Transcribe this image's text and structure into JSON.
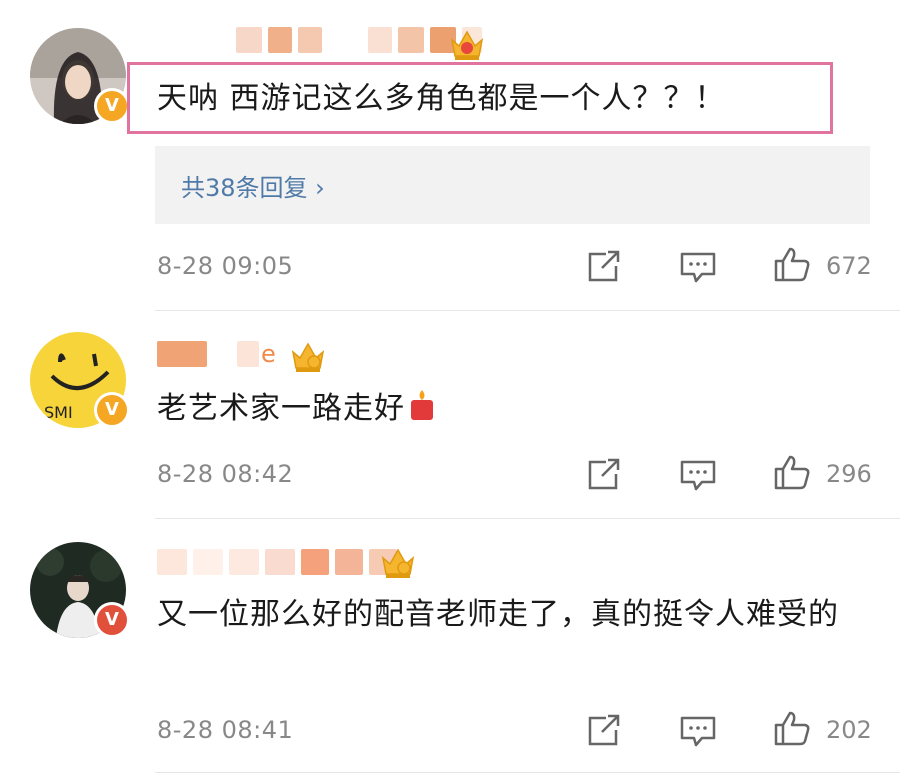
{
  "comments": [
    {
      "username": "",
      "text": "天呐 西游记这么多角色都是一个人？？！",
      "replies_label": "共38条回复 ›",
      "time": "8-28 09:05",
      "likes": "672"
    },
    {
      "username": "e",
      "text": "老艺术家一路走好",
      "time": "8-28 08:42",
      "likes": "296"
    },
    {
      "username": "",
      "text": "又一位那么好的配音老师走了，真的挺令人难受的",
      "time": "8-28 08:41",
      "likes": "202"
    }
  ],
  "icons": {
    "verified": "v-badge-icon",
    "crown": "crown-icon",
    "share": "share-icon",
    "comment": "comment-icon",
    "like": "like-icon",
    "candle": "candle-emoji-icon"
  },
  "badge_text": "V",
  "colors": {
    "highlight_border": "#e0749e",
    "reply_link": "#4f7aa8",
    "meta_gray": "#888888",
    "badge_orange": "#f5a623"
  }
}
